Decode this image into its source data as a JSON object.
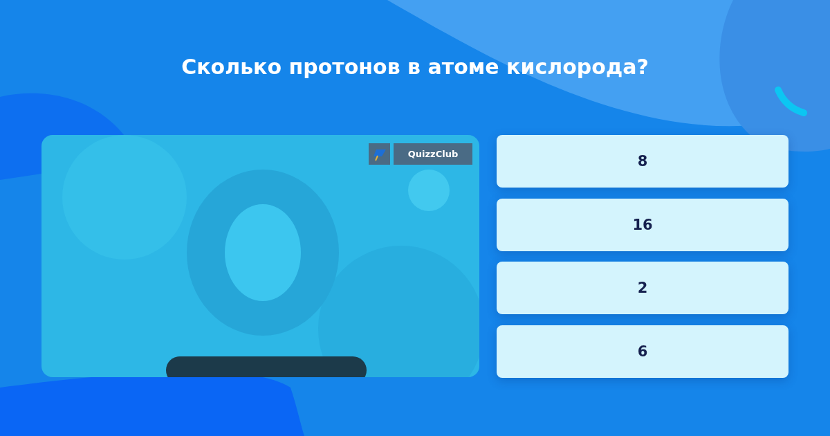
{
  "question": "Сколько протонов в атоме кислорода?",
  "brand": {
    "name": "QuizzClub"
  },
  "answers": [
    {
      "label": "8"
    },
    {
      "label": "16"
    },
    {
      "label": "2"
    },
    {
      "label": "6"
    }
  ]
}
